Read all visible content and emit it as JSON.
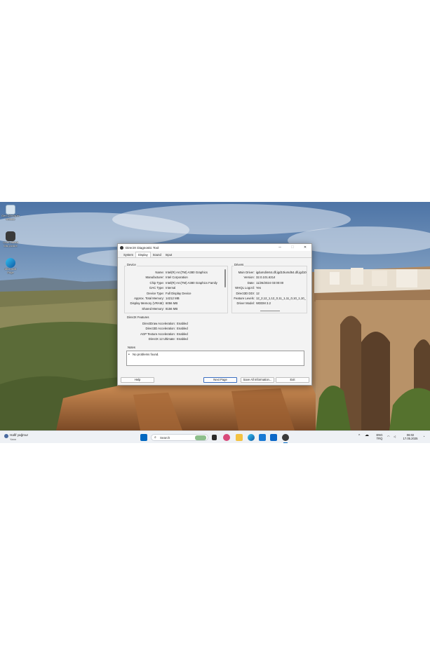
{
  "desktop": {
    "icons": [
      {
        "label": "Geri Dönüşüm Kutusu"
      },
      {
        "label": "Learn about this picture"
      },
      {
        "label": "Microsoft Edge"
      }
    ]
  },
  "window": {
    "title": "DirectX Diagnostic Tool",
    "controls": {
      "minimize": "─",
      "maximize": "☐",
      "close": "✕"
    },
    "tabs": [
      "System",
      "Display",
      "Sound",
      "Input"
    ],
    "active_tab": "Display",
    "device": {
      "title": "Device",
      "rows": [
        {
          "k": "Name:",
          "v": "Intel(R) Arc(TM) A380 Graphics"
        },
        {
          "k": "Manufacturer:",
          "v": "Intel Corporation"
        },
        {
          "k": "Chip Type:",
          "v": "Intel(R) Arc(TM) A380 Graphics Family"
        },
        {
          "k": "DAC Type:",
          "v": "Internal"
        },
        {
          "k": "Device Type:",
          "v": "Full Display Device"
        },
        {
          "k": "Approx. Total Memory:",
          "v": "14212 MB"
        },
        {
          "k": "Display Memory (VRAM):",
          "v": "6056 MB"
        },
        {
          "k": "Shared Memory:",
          "v": "8156 MB"
        }
      ]
    },
    "drivers": {
      "title": "Drivers",
      "rows": [
        {
          "k": "Main Driver:",
          "v": "igdumdim64.dll,igd10iumd64.dll,igd10i"
        },
        {
          "k": "Version:",
          "v": "32.0.101.6314"
        },
        {
          "k": "Date:",
          "v": "11/26/2024 03:00:00"
        },
        {
          "k": "WHQL Logo'd:",
          "v": "Yes"
        },
        {
          "k": "Direct3D DDI:",
          "v": "12"
        },
        {
          "k": "Feature Levels:",
          "v": "12_2,12_1,12_0,11_1,11_0,10_1,10_"
        },
        {
          "k": "Driver Model:",
          "v": "WDDM 3.2"
        }
      ]
    },
    "features": {
      "title": "DirectX Features",
      "rows": [
        {
          "k": "DirectDraw Acceleration:",
          "v": "Enabled"
        },
        {
          "k": "Direct3D Acceleration:",
          "v": "Enabled"
        },
        {
          "k": "AGP Texture Acceleration:",
          "v": "Enabled"
        },
        {
          "k": "DirectX 12 Ultimate:",
          "v": "Enabled"
        }
      ]
    },
    "notes": {
      "title": "Notes",
      "bullet": "•",
      "text": "No problems found."
    },
    "buttons": {
      "help": "Help",
      "next_page": "Next Page",
      "save_all": "Save All Information...",
      "exit": "Exit"
    }
  },
  "taskbar": {
    "weather": {
      "title": "Hafif yağmur",
      "subtitle": "Yarın"
    },
    "search_placeholder": "Search",
    "language": {
      "lang": "ENG",
      "layout": "TRQ"
    },
    "clock": {
      "time": "06:02",
      "date": "17.05.2025"
    },
    "colors": {
      "accent": "#0067c0",
      "taskbar": "#eef1f5"
    }
  }
}
